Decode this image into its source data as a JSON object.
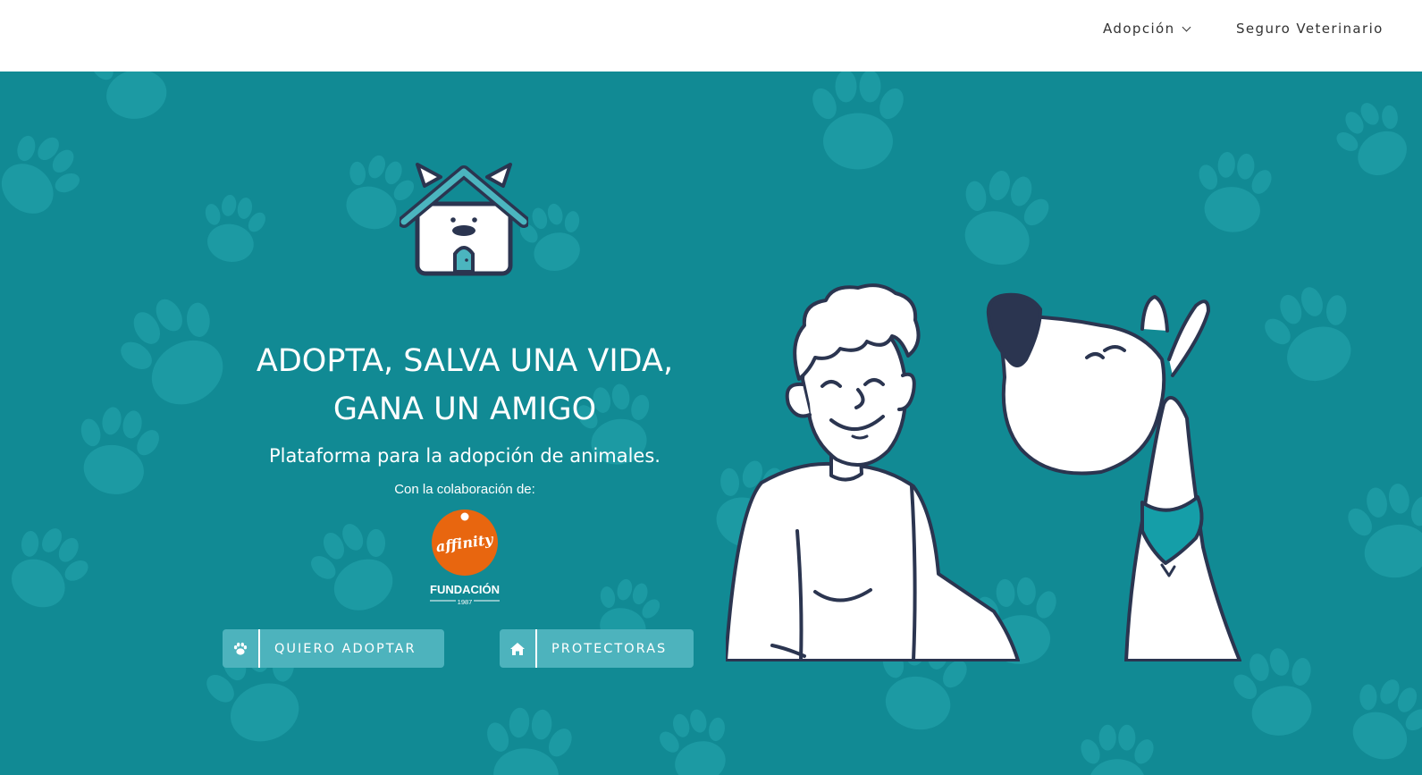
{
  "nav": {
    "items": [
      {
        "label": "Adopción",
        "has_dropdown": true
      },
      {
        "label": "Seguro Veterinario",
        "has_dropdown": false
      }
    ]
  },
  "hero": {
    "headline_line1": "ADOPTA, SALVA UNA VIDA,",
    "headline_line2": "GANA UN AMIGO",
    "subtitle": "Plataforma para la adopción de animales.",
    "collaboration_label": "Con la colaboración de:",
    "partner_logo": {
      "brand": "affinity",
      "name": "FUNDACIÓN",
      "year": "1987"
    },
    "buttons": [
      {
        "label": "QUIERO ADOPTAR",
        "icon": "paw-icon"
      },
      {
        "label": "PROTECTORAS",
        "icon": "home-icon"
      }
    ]
  },
  "colors": {
    "hero_background": "#118a94",
    "paw_pattern": "#1c9aa3",
    "button_background": "#4db3bd",
    "outline_navy": "#2b3550",
    "affinity_orange": "#e8660f",
    "nav_text": "#333333"
  }
}
